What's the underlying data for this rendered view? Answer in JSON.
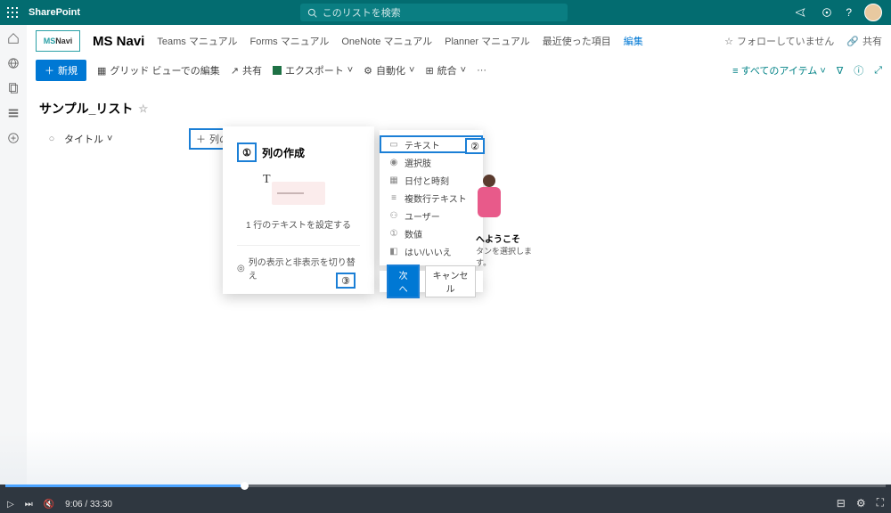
{
  "suite": {
    "app": "SharePoint",
    "search_placeholder": "このリストを検索"
  },
  "site": {
    "logo_text_a": "MS",
    "logo_text_b": "Navi",
    "name": "MS Navi",
    "nav": [
      "Teams マニュアル",
      "Forms マニュアル",
      "OneNote マニュアル",
      "Planner マニュアル",
      "最近使った項目"
    ],
    "nav_edit": "編集",
    "follow": "フォローしていません",
    "share": "共有"
  },
  "commands": {
    "new": "新規",
    "grid": "グリッド ビューでの編集",
    "share": "共有",
    "export": "エクスポート",
    "automate": "自動化",
    "integrate": "統合",
    "all_items": "すべてのアイテム"
  },
  "list": {
    "title": "サンプル_リスト",
    "col_title": "タイトル",
    "add_column": "列の追加"
  },
  "callout": {
    "title": "列の作成",
    "desc": "1 行のテキストを設定する",
    "footer": "列の表示と非表示を切り替え"
  },
  "types": [
    "テキスト",
    "選択肢",
    "日付と時刻",
    "複数行テキスト",
    "ユーザー",
    "数値",
    "はい/いいえ"
  ],
  "buttons": {
    "next": "次へ",
    "cancel": "キャンセル"
  },
  "annotations": {
    "a1": "①",
    "a2": "②",
    "a3": "③"
  },
  "hero": {
    "heading": "へようこそ",
    "sub": "タンを選択します。"
  },
  "video": {
    "time": "9:06 / 33:30"
  }
}
